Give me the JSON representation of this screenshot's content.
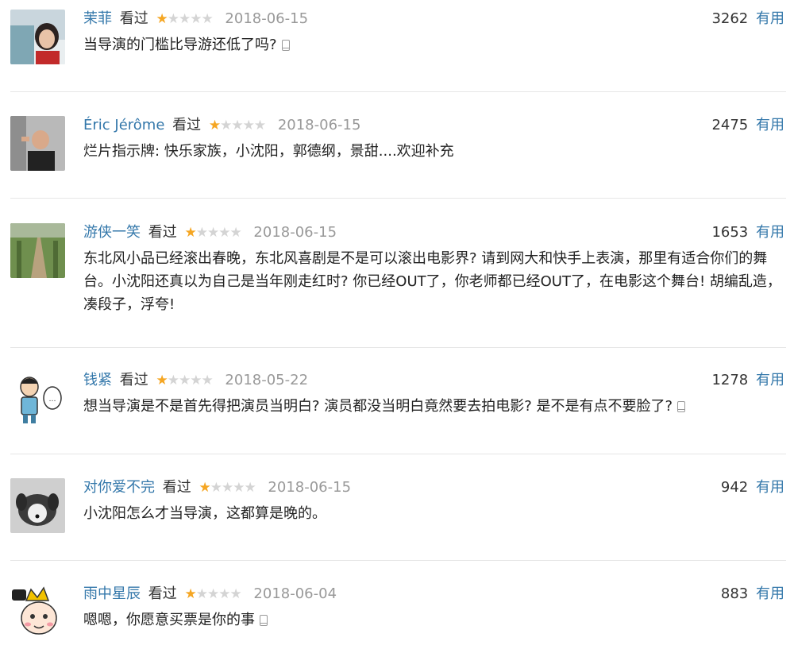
{
  "comments": [
    {
      "author": "茉菲",
      "status": "看过",
      "rating": 1,
      "date": "2018-06-15",
      "votes": "3262",
      "useful_label": "有用",
      "text": "当导演的门槛比导游还低了吗?",
      "from_mobile": true,
      "avatar_icon": "user-avatar-photo"
    },
    {
      "author": "Éric Jérôme",
      "status": "看过",
      "rating": 1,
      "date": "2018-06-15",
      "votes": "2475",
      "useful_label": "有用",
      "text": "烂片指示牌: 快乐家族，小沈阳，郭德纲，景甜....欢迎补充",
      "from_mobile": false,
      "avatar_icon": "user-avatar-photo"
    },
    {
      "author": "游侠一笑",
      "status": "看过",
      "rating": 1,
      "date": "2018-06-15",
      "votes": "1653",
      "useful_label": "有用",
      "text": "东北风小品已经滚出春晚，东北风喜剧是不是可以滚出电影界? 请到网大和快手上表演，那里有适合你们的舞台。小沈阳还真以为自己是当年刚走红时? 你已经OUT了，你老师都已经OUT了，在电影这个舞台! 胡编乱造，凑段子，浮夸!",
      "from_mobile": false,
      "avatar_icon": "user-avatar-photo"
    },
    {
      "author": "钱紧",
      "status": "看过",
      "rating": 1,
      "date": "2018-05-22",
      "votes": "1278",
      "useful_label": "有用",
      "text": "想当导演是不是首先得把演员当明白? 演员都没当明白竟然要去拍电影? 是不是有点不要脸了?",
      "from_mobile": true,
      "avatar_icon": "user-avatar-cartoon"
    },
    {
      "author": "对你爱不完",
      "status": "看过",
      "rating": 1,
      "date": "2018-06-15",
      "votes": "942",
      "useful_label": "有用",
      "text": "小沈阳怎么才当导演，这都算是晚的。",
      "from_mobile": false,
      "avatar_icon": "user-avatar-dog"
    },
    {
      "author": "雨中星辰",
      "status": "看过",
      "rating": 1,
      "date": "2018-06-04",
      "votes": "883",
      "useful_label": "有用",
      "text": "嗯嗯，你愿意买票是你的事",
      "from_mobile": true,
      "avatar_icon": "user-avatar-cartoon"
    }
  ],
  "colors": {
    "link": "#3377aa",
    "star_on": "#f5a623",
    "star_off": "#d4d4d4",
    "date": "#999999",
    "divider": "#e6e6e6"
  }
}
